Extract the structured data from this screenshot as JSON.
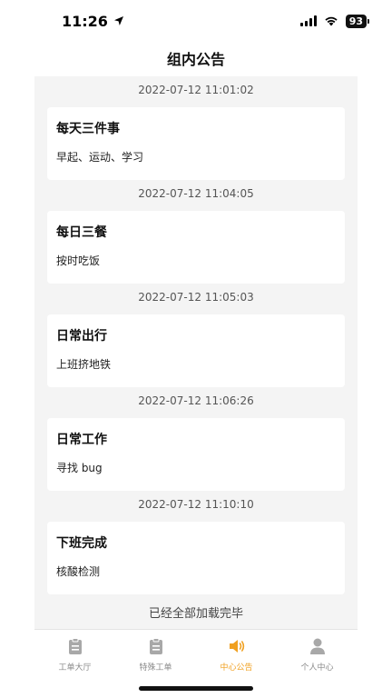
{
  "status_bar": {
    "time": "11:26",
    "battery": "93"
  },
  "header": {
    "title": "组内公告"
  },
  "announcements": [
    {
      "timestamp": "2022-07-12 11:01:02",
      "title": "每天三件事",
      "body": "早起、运动、学习"
    },
    {
      "timestamp": "2022-07-12 11:04:05",
      "title": "每日三餐",
      "body": "按时吃饭"
    },
    {
      "timestamp": "2022-07-12 11:05:03",
      "title": "日常出行",
      "body": "上班挤地铁"
    },
    {
      "timestamp": "2022-07-12 11:06:26",
      "title": "日常工作",
      "body": "寻找 bug"
    },
    {
      "timestamp": "2022-07-12 11:10:10",
      "title": "下班完成",
      "body": "核酸检测"
    }
  ],
  "list_end_text": "已经全部加载完毕",
  "tabbar": {
    "tabs": [
      {
        "label": "工单大厅",
        "icon": "clipboard-icon",
        "active": false
      },
      {
        "label": "特殊工单",
        "icon": "clipboard-icon",
        "active": false
      },
      {
        "label": "中心公告",
        "icon": "speaker-icon",
        "active": true
      },
      {
        "label": "个人中心",
        "icon": "person-icon",
        "active": false
      }
    ],
    "active_color": "#f0a020",
    "inactive_color": "#a8a8a8"
  }
}
